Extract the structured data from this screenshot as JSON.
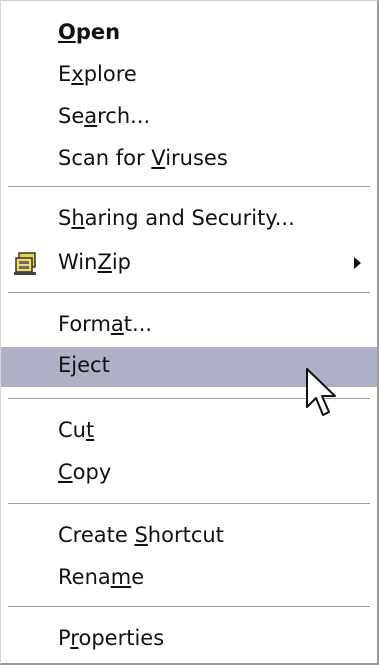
{
  "menu": {
    "items": [
      {
        "pre": "",
        "u": "O",
        "post": "pen"
      },
      {
        "pre": "E",
        "u": "x",
        "post": "plore"
      },
      {
        "pre": "Se",
        "u": "a",
        "post": "rch..."
      },
      {
        "pre": "Scan for ",
        "u": "V",
        "post": "iruses"
      },
      {
        "pre": "S",
        "u": "h",
        "post": "aring and Security..."
      },
      {
        "pre": "Win",
        "u": "Z",
        "post": "ip"
      },
      {
        "pre": "Form",
        "u": "a",
        "post": "t..."
      },
      {
        "pre": "E",
        "u": "j",
        "post": "ect"
      },
      {
        "pre": "Cu",
        "u": "t",
        "post": ""
      },
      {
        "pre": "",
        "u": "C",
        "post": "opy"
      },
      {
        "pre": "Create ",
        "u": "S",
        "post": "hortcut"
      },
      {
        "pre": "Rena",
        "u": "m",
        "post": "e"
      },
      {
        "pre": "P",
        "u": "r",
        "post": "operties"
      }
    ]
  },
  "icons": {
    "winzip": "winzip-icon",
    "submenu": "submenu-arrow-icon",
    "cursor": "mouse-pointer-icon"
  },
  "colors": {
    "highlight": "#aeb0c6",
    "separator": "#9f9f9f",
    "background": "#ffffff"
  }
}
